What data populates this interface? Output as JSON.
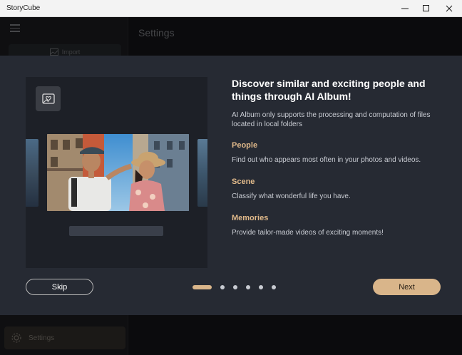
{
  "window": {
    "title": "StoryCube",
    "minimize_icon": "minimize-icon",
    "maximize_icon": "maximize-icon",
    "close_icon": "close-icon"
  },
  "sidebar": {
    "import_label": "Import",
    "settings_label": "Settings"
  },
  "main": {
    "page_title": "Settings"
  },
  "dialog": {
    "headline": "Discover similar and exciting people and things through AI Album!",
    "subtitle": "AI Album only supports the processing and computation of files located in local folders",
    "sections": [
      {
        "title": "People",
        "description": "Find out who appears most often in your photos and videos."
      },
      {
        "title": "Scene",
        "description": "Classify what wonderful life you have."
      },
      {
        "title": "Memories",
        "description": "Provide tailor-made videos of exciting moments!"
      }
    ],
    "skip_label": "Skip",
    "next_label": "Next",
    "pagination": {
      "total": 6,
      "current": 1
    }
  },
  "colors": {
    "accent": "#d9b58a",
    "dialog_bg": "#262a33",
    "section_title": "#e0b98a"
  }
}
